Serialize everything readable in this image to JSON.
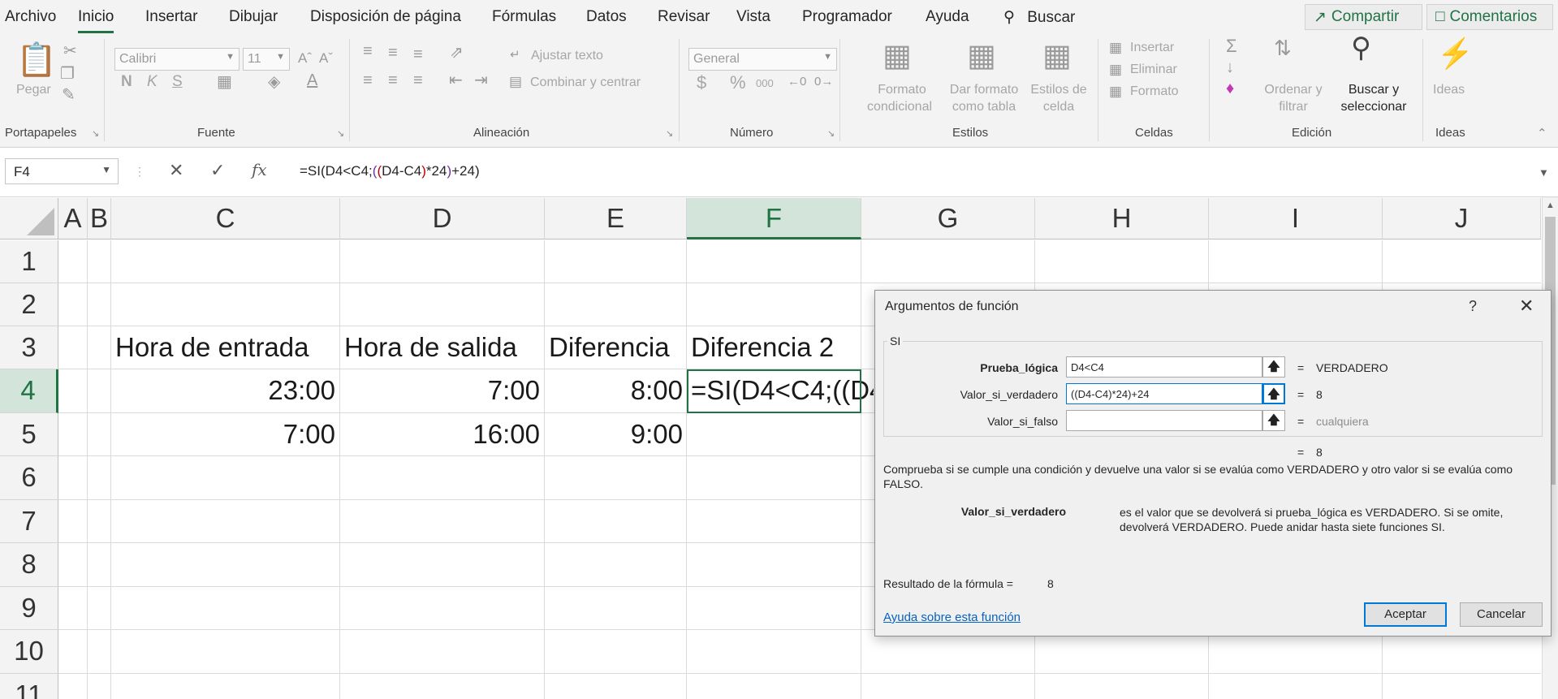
{
  "tabs": [
    "Archivo",
    "Inicio",
    "Insertar",
    "Dibujar",
    "Disposición de página",
    "Fórmulas",
    "Datos",
    "Revisar",
    "Vista",
    "Programador",
    "Ayuda"
  ],
  "search_label": "Buscar",
  "share_label": "Compartir",
  "comments_label": "Comentarios",
  "ribbon": {
    "clipboard": {
      "paste": "Pegar",
      "group": "Portapapeles"
    },
    "font": {
      "name": "Calibri",
      "size": "11",
      "bold": "N",
      "italic": "K",
      "underline": "S",
      "group": "Fuente"
    },
    "alignment": {
      "wrap": "Ajustar texto",
      "merge": "Combinar y centrar",
      "group": "Alineación"
    },
    "number": {
      "format": "General",
      "currency": "$",
      "percent": "%",
      "thousands": "000",
      "group": "Número"
    },
    "styles": {
      "conditional_1": "Formato",
      "conditional_2": "condicional",
      "table_1": "Dar formato",
      "table_2": "como tabla",
      "cell_1": "Estilos de",
      "cell_2": "celda",
      "group": "Estilos"
    },
    "cells": {
      "insert": "Insertar",
      "delete": "Eliminar",
      "format": "Formato",
      "group": "Celdas"
    },
    "editing": {
      "sort_1": "Ordenar y",
      "sort_2": "filtrar",
      "find_1": "Buscar y",
      "find_2": "seleccionar",
      "group": "Edición"
    },
    "ideas": {
      "label": "Ideas",
      "group": "Ideas"
    }
  },
  "formula_bar": {
    "name_box": "F4",
    "formula_prefix": "=SI(D4<C4;",
    "formula_p1": "(",
    "formula_p2": "(",
    "formula_mid": "D4-C4",
    "formula_p3": ")",
    "formula_mid2": "*24",
    "formula_p4": ")",
    "formula_suffix": "+24)"
  },
  "columns": [
    "A",
    "B",
    "C",
    "D",
    "E",
    "F",
    "G",
    "H",
    "I",
    "J"
  ],
  "rows": [
    "1",
    "2",
    "3",
    "4",
    "5",
    "6",
    "7",
    "8",
    "9",
    "10",
    "11"
  ],
  "cells": {
    "C3": "Hora de entrada",
    "D3": "Hora de salida",
    "E3": "Diferencia",
    "F3": "Diferencia 2",
    "C4": "23:00",
    "D4": "7:00",
    "E4": "8:00",
    "F4": "=SI(D4<C4;((D4-C4)*24)+24)",
    "C5": "7:00",
    "D5": "16:00",
    "E5": "9:00"
  },
  "dialog": {
    "title": "Argumentos de función",
    "help": "?",
    "close": "✕",
    "function_name": "SI",
    "args": [
      {
        "label": "Prueba_lógica",
        "value": "D4<C4",
        "result": "VERDADERO",
        "bold": true
      },
      {
        "label": "Valor_si_verdadero",
        "value": "((D4-C4)*24)+24",
        "result": "8",
        "bold": false
      },
      {
        "label": "Valor_si_falso",
        "value": "",
        "result": "cualquiera",
        "bold": false
      }
    ],
    "overall_result": "8",
    "description": "Comprueba si se cumple una condición y devuelve una valor si se evalúa como VERDADERO y otro valor si se evalúa como FALSO.",
    "arg_help_name": "Valor_si_verdadero",
    "arg_help_text": "es el valor que se devolverá si prueba_lógica es VERDADERO. Si se omite, devolverá VERDADERO. Puede anidar hasta siete funciones SI.",
    "formula_result_label": "Resultado de la fórmula =",
    "formula_result_value": "8",
    "help_link": "Ayuda sobre esta función",
    "ok": "Aceptar",
    "cancel": "Cancelar"
  },
  "colors": {
    "accent": "#217346",
    "dialog_focus": "#0078d7",
    "link": "#0563c1"
  }
}
